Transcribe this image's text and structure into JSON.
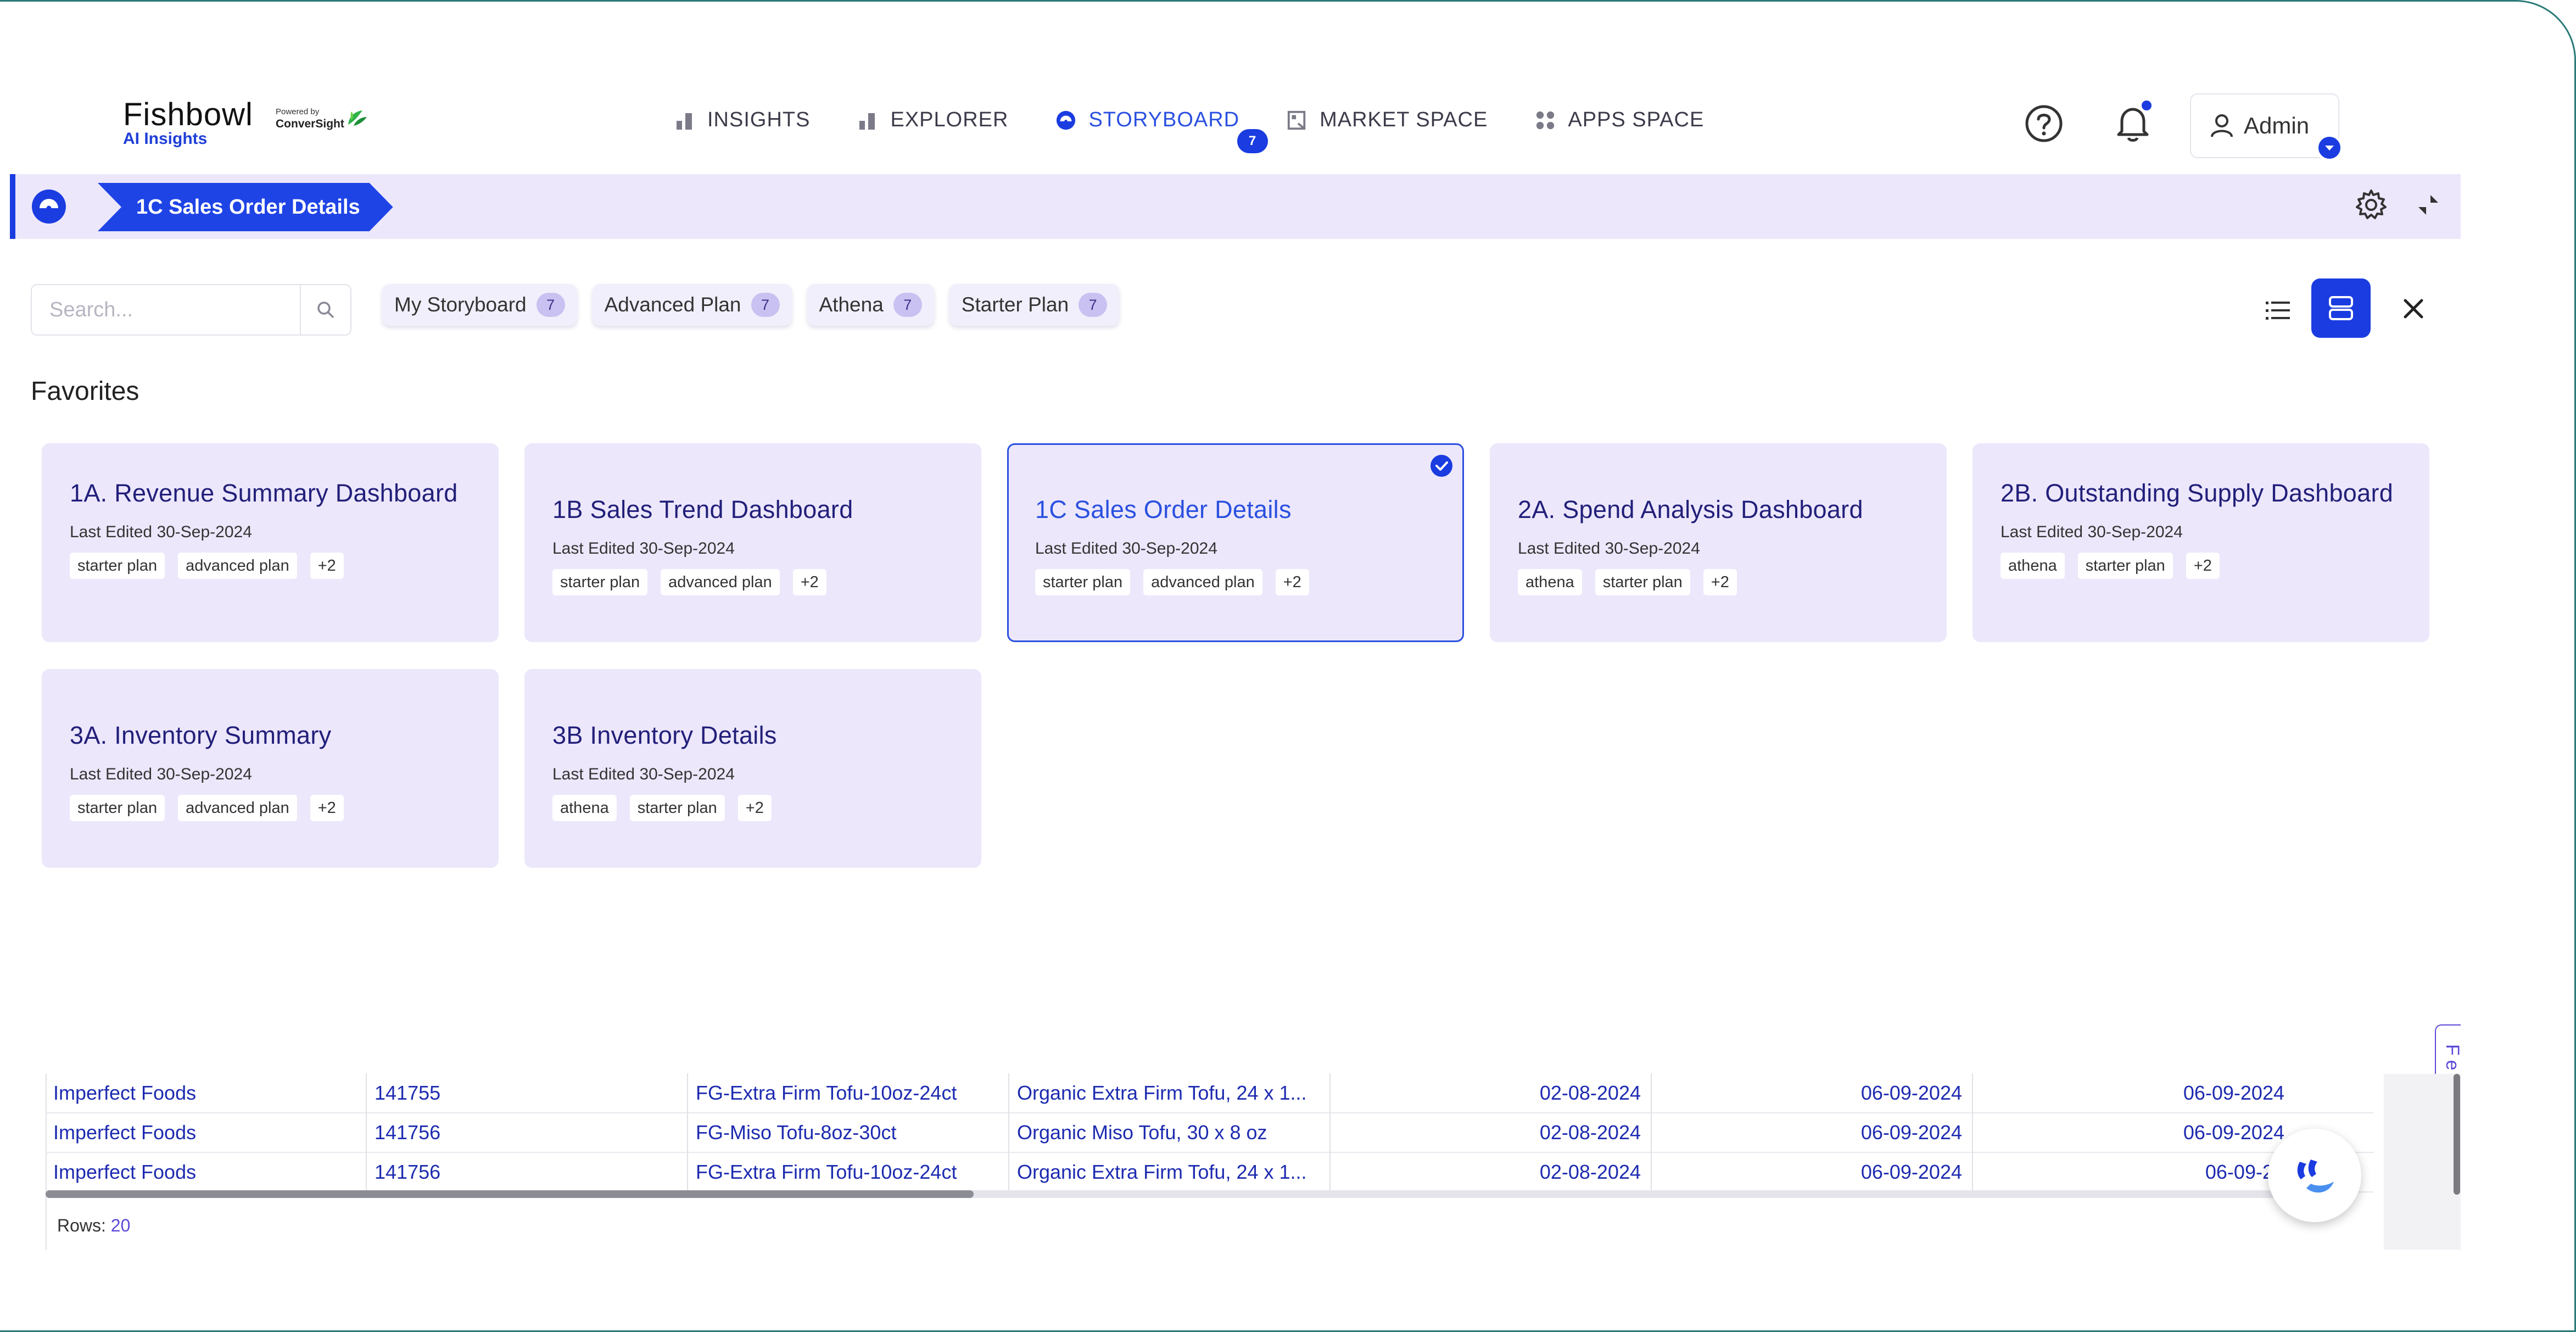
{
  "header": {
    "logo_main": "Fishbowl",
    "logo_sub": "AI Insights",
    "powered_by": "Powered by",
    "powered_brand": "ConverSight",
    "nav": [
      {
        "label": "INSIGHTS",
        "icon": "bar-chart-icon"
      },
      {
        "label": "EXPLORER",
        "icon": "bar-chart-icon"
      },
      {
        "label": "STORYBOARD",
        "icon": "storyboard-icon",
        "active": true,
        "badge": "7"
      },
      {
        "label": "MARKET SPACE",
        "icon": "market-icon"
      },
      {
        "label": "APPS SPACE",
        "icon": "apps-grid-icon"
      }
    ],
    "user_label": "Admin"
  },
  "breadcrumb": {
    "current": "1C Sales Order Details"
  },
  "panel": {
    "search_placeholder": "Search...",
    "filters": [
      {
        "label": "My Storyboard",
        "count": "7"
      },
      {
        "label": "Advanced Plan",
        "count": "7"
      },
      {
        "label": "Athena",
        "count": "7"
      },
      {
        "label": "Starter Plan",
        "count": "7"
      }
    ],
    "section_title": "Favorites",
    "cards": [
      {
        "title": "1A. Revenue Summary Dashboard",
        "date": "Last Edited 30-Sep-2024",
        "tags": [
          "starter plan",
          "advanced plan",
          "+2"
        ]
      },
      {
        "title": "1B Sales Trend Dashboard",
        "date": "Last Edited 30-Sep-2024",
        "tags": [
          "starter plan",
          "advanced plan",
          "+2"
        ]
      },
      {
        "title": "1C Sales Order Details",
        "date": "Last Edited 30-Sep-2024",
        "tags": [
          "starter plan",
          "advanced plan",
          "+2"
        ],
        "selected": true
      },
      {
        "title": "2A. Spend Analysis Dashboard",
        "date": "Last Edited 30-Sep-2024",
        "tags": [
          "athena",
          "starter plan",
          "+2"
        ]
      },
      {
        "title": "2B. Outstanding Supply Dashboard",
        "date": "Last Edited 30-Sep-2024",
        "tags": [
          "athena",
          "starter plan",
          "+2"
        ]
      },
      {
        "title": "3A. Inventory Summary",
        "date": "Last Edited 30-Sep-2024",
        "tags": [
          "starter plan",
          "advanced plan",
          "+2"
        ]
      },
      {
        "title": "3B Inventory Details",
        "date": "Last Edited 30-Sep-2024",
        "tags": [
          "athena",
          "starter plan",
          "+2"
        ]
      }
    ],
    "feedback_label": "Feedback"
  },
  "table": {
    "rows": [
      [
        "Imperfect Foods",
        "141755",
        "FG-Extra Firm Tofu-10oz-24ct",
        "Organic Extra Firm Tofu, 24 x 1...",
        "02-08-2024",
        "06-09-2024",
        "06-09-2024"
      ],
      [
        "Imperfect Foods",
        "141756",
        "FG-Miso Tofu-8oz-30ct",
        "Organic Miso Tofu, 30 x 8 oz",
        "02-08-2024",
        "06-09-2024",
        "06-09-2024"
      ],
      [
        "Imperfect Foods",
        "141756",
        "FG-Extra Firm Tofu-10oz-24ct",
        "Organic Extra Firm Tofu, 24 x 1...",
        "02-08-2024",
        "06-09-2024",
        "06-09-20"
      ]
    ],
    "rows_label": "Rows:",
    "rows_count": "20"
  },
  "colors": {
    "accent": "#1a3ce0",
    "card_bg": "#ece7fb",
    "card_title": "#221f7a"
  }
}
